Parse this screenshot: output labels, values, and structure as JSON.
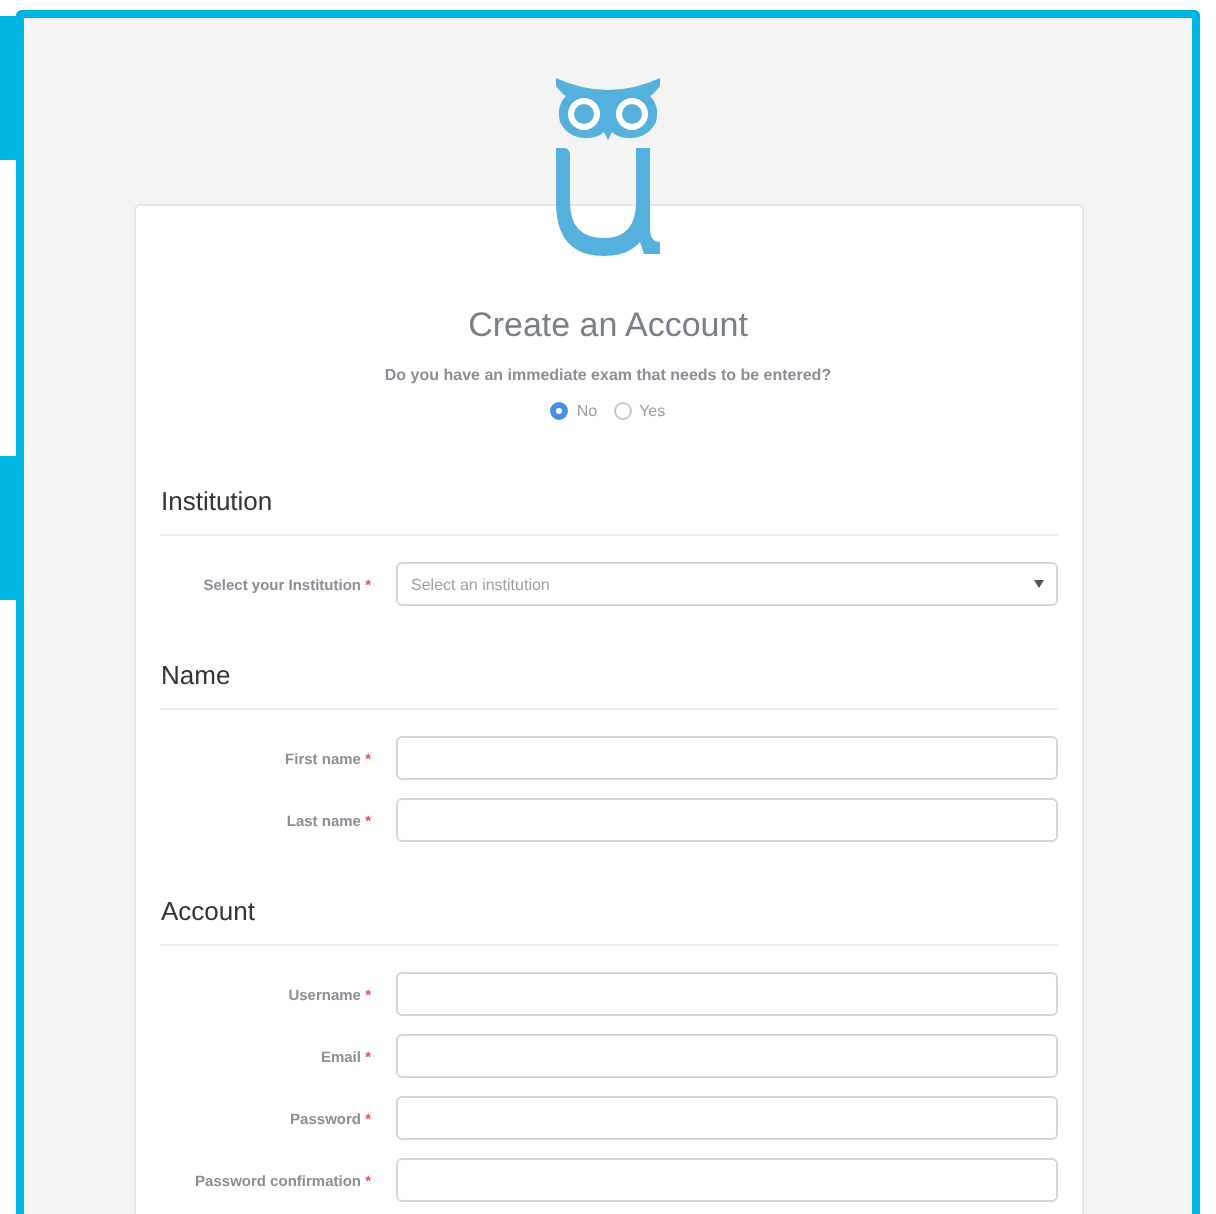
{
  "title": "Create an Account",
  "question": "Do you have an immediate exam that needs to be entered?",
  "options": [
    {
      "label": "No",
      "selected": true
    },
    {
      "label": "Yes",
      "selected": false
    }
  ],
  "sections": [
    {
      "heading": "Institution",
      "fields": [
        {
          "kind": "select",
          "label": "Select your Institution",
          "required_mark": "*",
          "placeholder": "Select an institution"
        }
      ]
    },
    {
      "heading": "Name",
      "fields": [
        {
          "kind": "input",
          "label": "First name",
          "required_mark": "*"
        },
        {
          "kind": "input",
          "label": "Last name",
          "required_mark": "*"
        }
      ]
    },
    {
      "heading": "Account",
      "fields": [
        {
          "kind": "input",
          "label": "Username",
          "required_mark": "*"
        },
        {
          "kind": "input",
          "label": "Email",
          "required_mark": "*"
        },
        {
          "kind": "input",
          "label": "Password",
          "required_mark": "*"
        },
        {
          "kind": "input",
          "label": "Password confirmation",
          "required_mark": "*"
        }
      ]
    }
  ]
}
